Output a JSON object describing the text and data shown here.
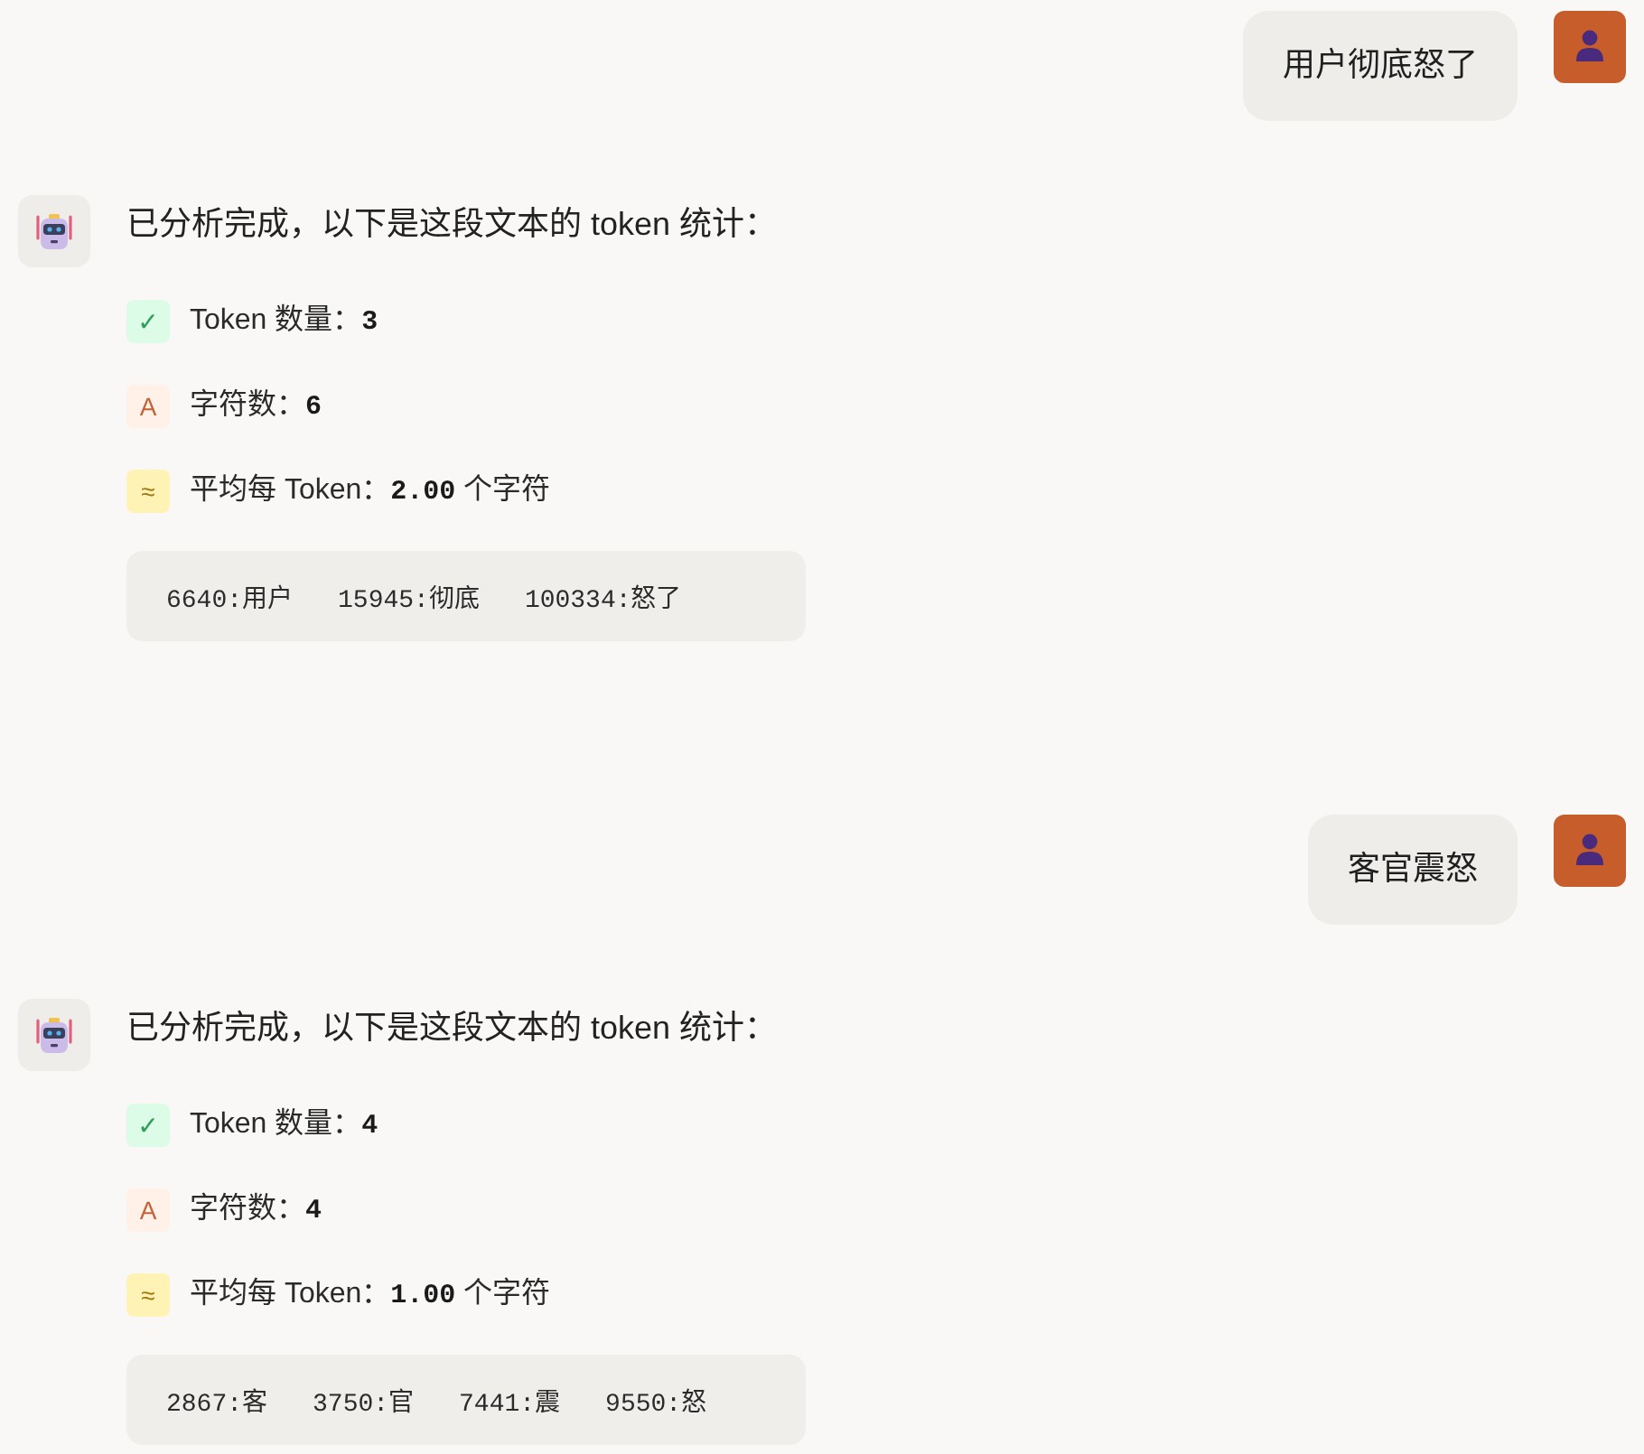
{
  "messages": [
    {
      "kind": "user",
      "text": "用户彻底怒了"
    },
    {
      "kind": "assistant",
      "text": "已分析完成，以下是这段文本的 token 统计：",
      "stats": [
        {
          "kind": "check",
          "icon": "✓",
          "text": "Token 数量：**3**"
        },
        {
          "kind": "letter",
          "icon": "A",
          "text": "字符数：**6**"
        },
        {
          "kind": "approx",
          "icon": "≈",
          "text": "平均每 Token：**2.00** 个字符"
        }
      ],
      "tokens": [
        "6640:用户",
        "15945:彻底",
        "100334:怒了"
      ]
    },
    {
      "kind": "user",
      "text": "客官震怒"
    },
    {
      "kind": "assistant",
      "text": "已分析完成，以下是这段文本的 token 统计：",
      "stats": [
        {
          "kind": "check",
          "icon": "✓",
          "text": "Token 数量：**4**"
        },
        {
          "kind": "letter",
          "icon": "A",
          "text": "字符数：**4**"
        },
        {
          "kind": "approx",
          "icon": "≈",
          "text": "平均每 Token：**1.00** 个字符"
        }
      ],
      "tokens": [
        "2867:客",
        "3750:官",
        "7441:震",
        "9550:怒"
      ]
    }
  ]
}
